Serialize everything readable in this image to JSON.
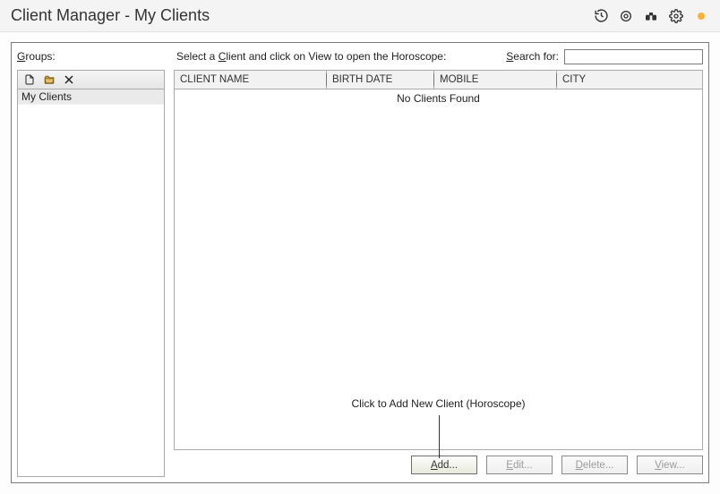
{
  "title": "Client Manager - My Clients",
  "labels": {
    "groups_first": "G",
    "groups_rest": "roups:",
    "instruction_prefix": "Select a ",
    "instruction_ul": "C",
    "instruction_rest": "lient and click on View to open the Horoscope:",
    "search_first": "S",
    "search_rest": "earch for:"
  },
  "search": {
    "value": ""
  },
  "sidebar": {
    "items": [
      {
        "label": "My Clients"
      }
    ]
  },
  "table": {
    "columns": [
      "CLIENT NAME",
      "BIRTH DATE",
      "MOBILE",
      "CITY"
    ],
    "empty_message": "No Clients Found",
    "hint_text": "Click to Add New Client (Horoscope)"
  },
  "buttons": {
    "add_ul": "A",
    "add_rest": "dd...",
    "edit_ul": "E",
    "edit_rest": "dit...",
    "delete_ul": "D",
    "delete_rest": "elete...",
    "view_ul": "V",
    "view_rest": "iew..."
  }
}
